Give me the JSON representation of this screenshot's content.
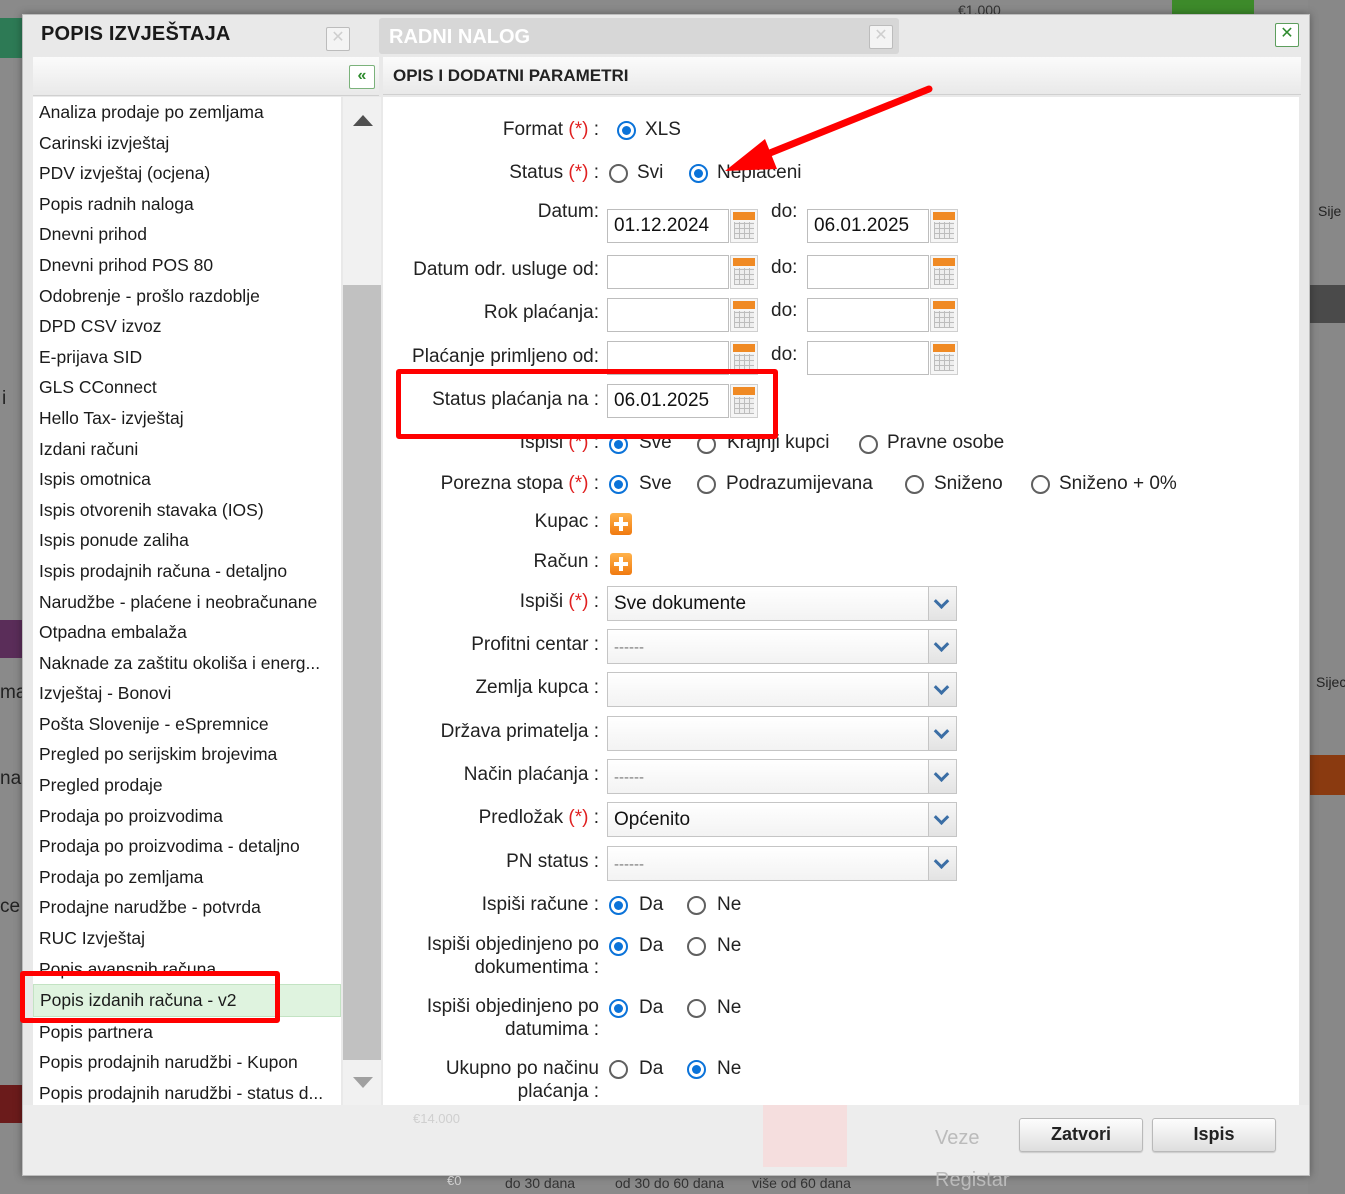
{
  "background": {
    "money_label": "€1.000",
    "side_labels": [
      "Sije",
      "Sijec"
    ],
    "frag_labels": [
      "i",
      "ma",
      "na",
      "ce"
    ],
    "bottom_axis": [
      "do 30 dana",
      "od 30 do 60 dana",
      "više od 60 dana"
    ],
    "bottom_values": [
      "€14.000",
      "€0"
    ],
    "bottom_links": [
      "Veze",
      "Registar"
    ]
  },
  "dialog": {
    "title": "POPIS IZVJEŠTAJA",
    "ghost_title": "RADNI NALOG",
    "close_glyph": "✕"
  },
  "left": {
    "collapse_glyph": "«",
    "items": [
      "Analiza prodaje po zemljama",
      "Carinski izvještaj",
      "PDV izvještaj (ocjena)",
      "Popis radnih naloga",
      "Dnevni prihod",
      "Dnevni prihod POS 80",
      "Odobrenje - prošlo razdoblje",
      "DPD CSV izvoz",
      "E-prijava SID",
      "GLS CConnect",
      "Hello Tax- izvještaj",
      "Izdani računi",
      "Ispis omotnica",
      "Ispis otvorenih stavaka (IOS)",
      "Ispis ponude zaliha",
      "Ispis prodajnih računa - detaljno",
      "Narudžbe - plaćene i neobračunane",
      "Otpadna embalaža",
      "Naknade za zaštitu okoliša i energ...",
      "Izvještaj - Bonovi",
      "Pošta Slovenije - eSpremnice",
      "Pregled po serijskim brojevima",
      "Pregled prodaje",
      "Prodaja po proizvodima",
      "Prodaja po proizvodima - detaljno",
      "Prodaja po zemljama",
      "Prodajne narudžbe - potvrda",
      "RUC Izvještaj",
      "Popis avansnih računa",
      "Popis izdanih računa - v2",
      "Popis partnera",
      "Popis prodajnih narudžbi - Kupon",
      "Popis prodajnih narudžbi - status d..."
    ]
  },
  "form": {
    "header": "OPIS I DODATNI PARAMETRI",
    "required_mark": "(*)",
    "colon": ":",
    "format": {
      "label": "Format",
      "option": "XLS"
    },
    "status": {
      "label": "Status",
      "options": [
        "Svi",
        "Neplaćeni"
      ],
      "selected": "Neplaćeni"
    },
    "datum": {
      "label": "Datum:",
      "from": "01.12.2024",
      "to_label": "do:",
      "to": "06.01.2025"
    },
    "datum_odr": {
      "label": "Datum odr. usluge od:",
      "to_label": "do:"
    },
    "rok": {
      "label": "Rok plaćanja:",
      "to_label": "do:"
    },
    "placanje": {
      "label": "Plaćanje primljeno od:",
      "to_label": "do:"
    },
    "status_placanja": {
      "label": "Status plaćanja na :",
      "value": "06.01.2025"
    },
    "ispisi_kupci": {
      "label": "Ispisi",
      "options": [
        "Sve",
        "Krajnji kupci",
        "Pravne osobe"
      ]
    },
    "porezna": {
      "label": "Porezna stopa",
      "options": [
        "Sve",
        "Podrazumijevana",
        "Sniženo",
        "Sniženo + 0%"
      ]
    },
    "kupac": {
      "label": "Kupac :"
    },
    "racun": {
      "label": "Račun :"
    },
    "ispisi_dok": {
      "label": "Ispiši",
      "value": "Sve dokumente"
    },
    "profitni": {
      "label": "Profitni centar :",
      "value": "------"
    },
    "zemlja": {
      "label": "Zemlja kupca :",
      "value": ""
    },
    "drzava": {
      "label": "Država primatelja :",
      "value": ""
    },
    "nacin": {
      "label": "Način plaćanja :",
      "value": "------"
    },
    "predlozak": {
      "label": "Predložak",
      "value": "Općenito"
    },
    "pn_status": {
      "label": "PN status :",
      "value": "------"
    },
    "yes": "Da",
    "no": "Ne",
    "ispisi_racune": {
      "label": "Ispiši račune :"
    },
    "obj_dok": {
      "label1": "Ispiši objedinjeno po",
      "label2": "dokumentima :"
    },
    "obj_dat": {
      "label1": "Ispiši objedinjeno po",
      "label2": "datumima :"
    },
    "ukupno": {
      "label1": "Ukupno po načinu",
      "label2": "plaćanja :"
    }
  },
  "buttons": {
    "close": "Zatvori",
    "print": "Ispis"
  }
}
